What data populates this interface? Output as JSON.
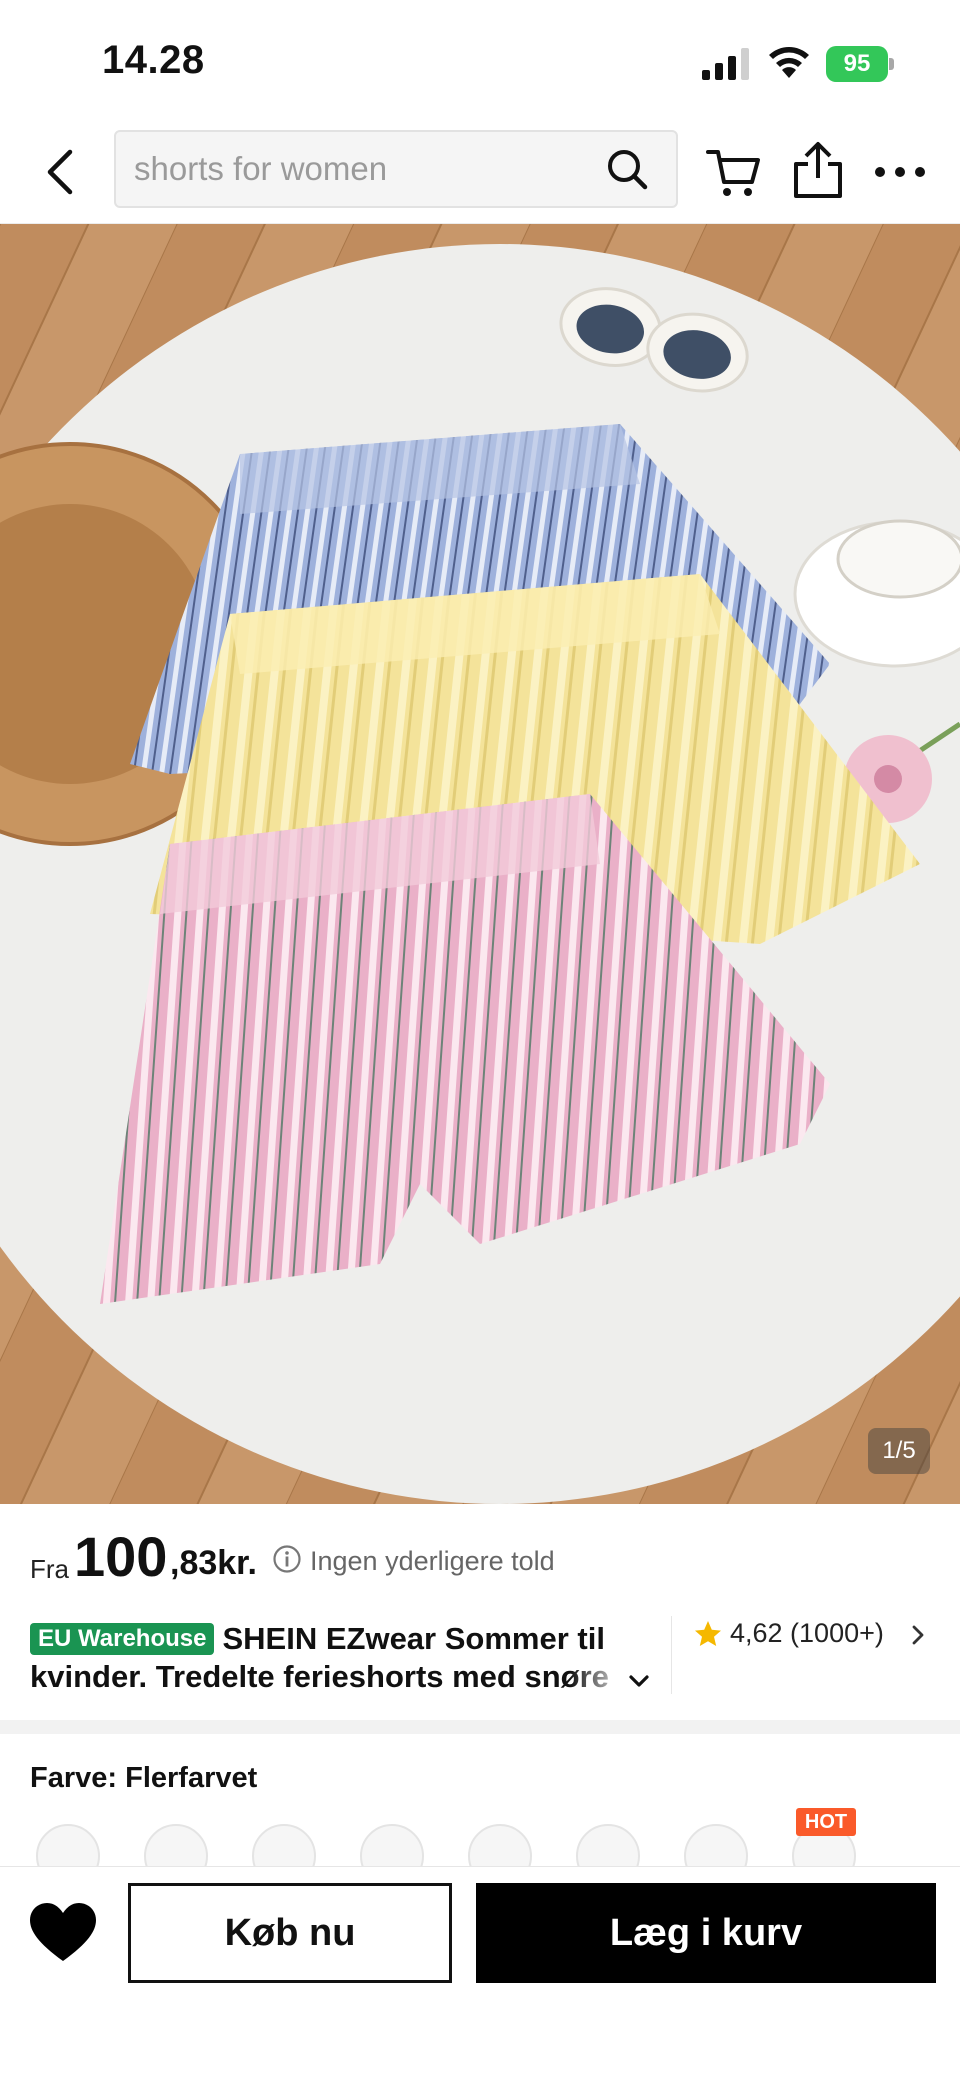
{
  "status_bar": {
    "time": "14.28",
    "battery": "95"
  },
  "nav": {
    "search_placeholder": "shorts for women"
  },
  "hero": {
    "counter": "1/5"
  },
  "price": {
    "from_label": "Fra",
    "integer": "100",
    "decimal": ",83kr.",
    "duty_note": "Ingen yderligere told"
  },
  "product": {
    "badge": "EU Warehouse",
    "title_line1": "SHEIN EZwear Sommer til",
    "title_line2": "kvinder. Tredelte ferieshorts med snøre",
    "rating": "4,62 (1000+)"
  },
  "color": {
    "label": "Farve: Flerfarvet",
    "hot_badge": "HOT",
    "swatch_count": 8
  },
  "actions": {
    "buy_now": "Køb nu",
    "add_to_cart": "Læg i kurv"
  },
  "colors": {
    "brand_green": "#1a9452",
    "hot": "#fa5a2a",
    "battery": "#33c759",
    "star": "#f5b800"
  },
  "icons": [
    "back-icon",
    "search-icon",
    "cart-icon",
    "share-icon",
    "more-icon",
    "info-icon",
    "star-icon",
    "chevron-right-icon",
    "chevron-down-icon",
    "heart-icon"
  ]
}
